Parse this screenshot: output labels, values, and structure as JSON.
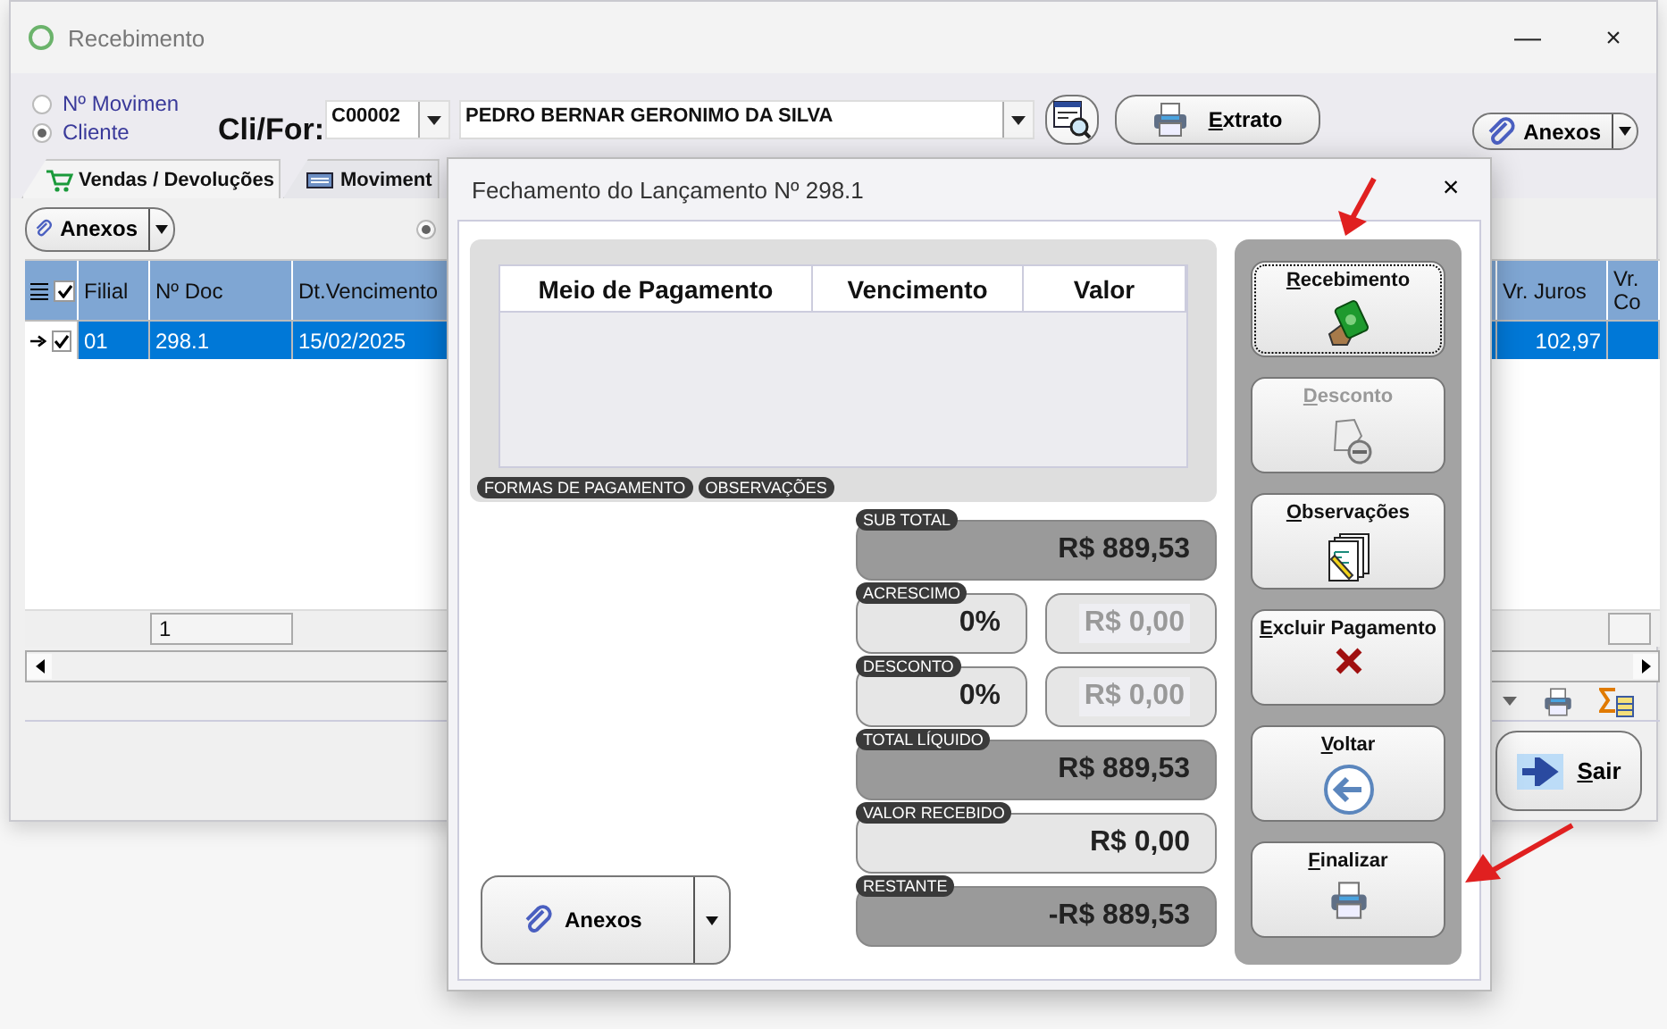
{
  "window": {
    "title": "Recebimento",
    "minimize": "—",
    "close": "×"
  },
  "search_mode": [
    {
      "label": "Nº Movimen",
      "selected": false
    },
    {
      "label": "Cliente",
      "selected": true
    }
  ],
  "client": {
    "label": "Cli/For:",
    "code": "C00002",
    "name": "PEDRO BERNAR GERONIMO DA SILVA"
  },
  "statement_button": "Extrato",
  "top_attachments_button": "Anexos",
  "tabs": [
    {
      "label": "Vendas / Devoluções",
      "selected": true
    },
    {
      "label": "Moviment",
      "selected": false
    }
  ],
  "attachments_button": "Anexos",
  "filter_radio": {
    "selected": true
  },
  "grid": {
    "columns": [
      "Filial",
      "Nº Doc",
      "Dt.Vencimento",
      "Vr. Juros",
      "Vr. Co"
    ],
    "rows": [
      {
        "checked": true,
        "selected": true,
        "filial": "01",
        "doc": "298.1",
        "due": "15/02/2025",
        "interest": "102,97"
      }
    ],
    "footer_count": "1"
  },
  "exit_button": "Sair",
  "dialog": {
    "title": "Fechamento do Lançamento Nº 298.1",
    "close": "×",
    "payments": {
      "columns": [
        "Meio de Pagamento",
        "Vencimento",
        "Valor"
      ]
    },
    "tags": [
      "FORMAS DE PAGAMENTO",
      "OBSERVAÇÕES"
    ],
    "totals": [
      {
        "kind": "total",
        "label": "SUB TOTAL",
        "value": "R$ 889,53"
      },
      {
        "kind": "split",
        "label": "ACRESCIMO",
        "percent": "0%",
        "amount": "R$ 0,00"
      },
      {
        "kind": "split",
        "label": "DESCONTO",
        "percent": "0%",
        "amount": "R$ 0,00"
      },
      {
        "kind": "total",
        "label": "TOTAL LÍQUIDO",
        "value": "R$ 889,53"
      },
      {
        "kind": "entry",
        "label": "VALOR RECEBIDO",
        "value": "R$ 0,00"
      },
      {
        "kind": "total",
        "label": "RESTANTE",
        "value": "-R$ 889,53"
      }
    ],
    "attachments_button": "Anexos",
    "actions": [
      {
        "kind": "money",
        "label": "Recebimento",
        "disabled": false,
        "focused": true
      },
      {
        "kind": "discount",
        "label": "Desconto",
        "disabled": true,
        "focused": false
      },
      {
        "kind": "notes",
        "label": "Observações",
        "disabled": false,
        "focused": false
      },
      {
        "kind": "delete",
        "label": "Excluir Pagamento",
        "disabled": false,
        "focused": false
      },
      {
        "kind": "back",
        "label": "Voltar",
        "disabled": false,
        "focused": false
      },
      {
        "kind": "print",
        "label": "Finalizar",
        "disabled": false,
        "focused": false
      }
    ]
  }
}
